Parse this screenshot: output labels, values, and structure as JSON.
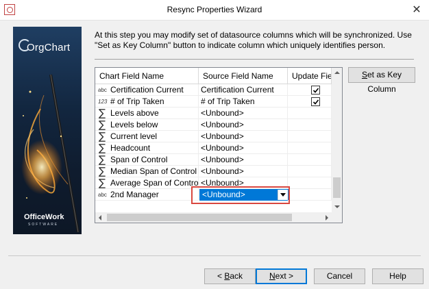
{
  "window": {
    "title": "Resync Properties Wizard",
    "close_glyph": "✕",
    "app_icon": "orgchart-app-icon"
  },
  "banner": {
    "product_logo": "OrgChart",
    "vendor_logo": "OfficeWork",
    "vendor_subtitle": "SOFTWARE"
  },
  "instructions": "At this step you may modify set of datasource columns which will be synchronized. Use \"Set as Key Column\" button to indicate column which uniquely identifies person.",
  "grid": {
    "headers": [
      "Chart Field Name",
      "Source Field Name",
      "Update Field"
    ],
    "rows": [
      {
        "type_icon": "abc",
        "type": "text",
        "name": "Certification Current",
        "source": "Certification Current",
        "update": true
      },
      {
        "type_icon": "123",
        "type": "number",
        "name": "# of Trip Taken",
        "source": "# of Trip Taken",
        "update": true
      },
      {
        "type_icon": "∑",
        "type": "sigma",
        "name": "Levels above",
        "source": "<Unbound>",
        "update": false
      },
      {
        "type_icon": "∑",
        "type": "sigma",
        "name": "Levels below",
        "source": "<Unbound>",
        "update": false
      },
      {
        "type_icon": "∑",
        "type": "sigma",
        "name": "Current level",
        "source": "<Unbound>",
        "update": false
      },
      {
        "type_icon": "∑",
        "type": "sigma",
        "name": "Headcount",
        "source": "<Unbound>",
        "update": false
      },
      {
        "type_icon": "∑",
        "type": "sigma",
        "name": "Span of Control",
        "source": "<Unbound>",
        "update": false
      },
      {
        "type_icon": "∑",
        "type": "sigma",
        "name": "Median Span of Control",
        "source": "<Unbound>",
        "update": false
      },
      {
        "type_icon": "∑",
        "type": "sigma",
        "name": "Average Span of Control",
        "source": "<Unbound>",
        "update": false
      },
      {
        "type_icon": "abc",
        "type": "text",
        "name": "2nd Manager",
        "source": "<Unbound>",
        "update": false,
        "editing": true
      }
    ]
  },
  "buttons": {
    "set_key_prefix": "",
    "set_key_u": "S",
    "set_key_rest": "et as Key Column",
    "back_prefix": "< ",
    "back_u": "B",
    "back_rest": "ack",
    "next_u": "N",
    "next_rest": "ext >",
    "cancel": "Cancel",
    "help": "Help"
  },
  "colors": {
    "selection": "#0078d7",
    "highlight_box": "#d9473f"
  }
}
